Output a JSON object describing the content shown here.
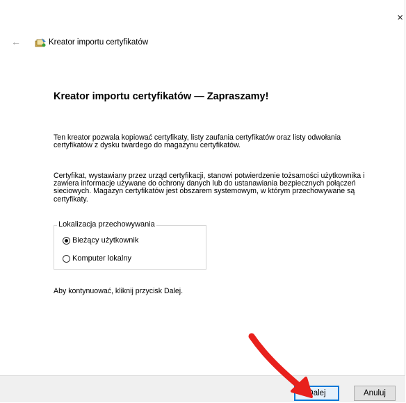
{
  "window": {
    "close_glyph": "×"
  },
  "header": {
    "back_glyph": "←",
    "title": "Kreator importu certyfikatów"
  },
  "content": {
    "heading": "Kreator importu certyfikatów — Zapraszamy!",
    "paragraph1": "Ten kreator pozwala kopiować certyfikaty, listy zaufania certyfikatów oraz listy odwołania certyfikatów z dysku twardego do magazynu certyfikatów.",
    "paragraph2": "Certyfikat, wystawiany przez urząd certyfikacji, stanowi potwierdzenie tożsamości użytkownika i zawiera informacje używane do ochrony danych lub do ustanawiania bezpiecznych połączeń sieciowych. Magazyn certyfikatów jest obszarem systemowym, w którym przechowywane są certyfikaty.",
    "store_location": {
      "legend": "Lokalizacja przechowywania",
      "options": [
        {
          "label": "Bieżący użytkownik",
          "checked": true
        },
        {
          "label": "Komputer lokalny",
          "checked": false
        }
      ]
    },
    "hint": "Aby kontynuować, kliknij przycisk Dalej."
  },
  "footer": {
    "next_label": "Dalej",
    "cancel_label": "Anuluj"
  },
  "annotation": {
    "color": "#e8201c",
    "icon": "red-arrow-annotation"
  }
}
